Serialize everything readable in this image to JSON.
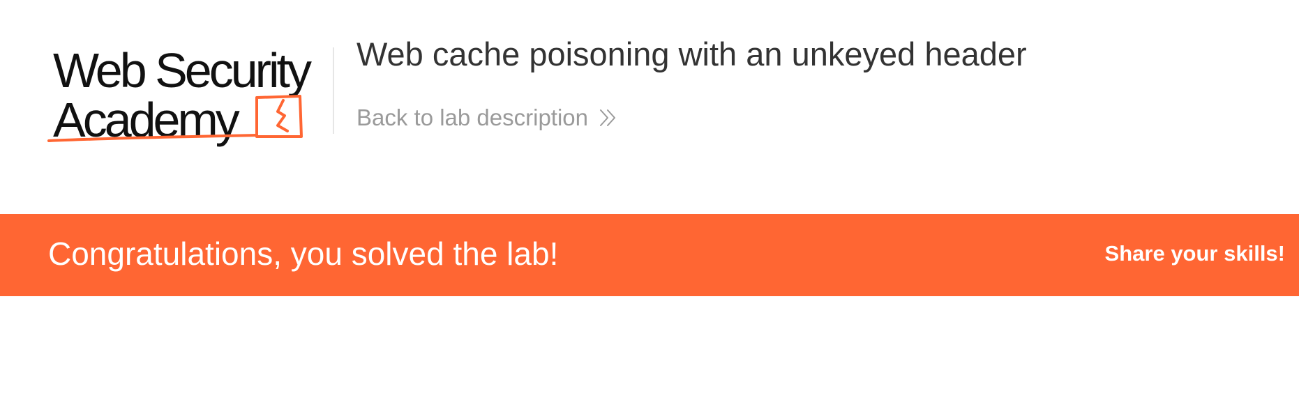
{
  "logo": {
    "line1": "Web Security",
    "line2": "Academy"
  },
  "lab": {
    "title": "Web cache poisoning with an unkeyed header",
    "back_link_label": "Back to lab description"
  },
  "banner": {
    "message": "Congratulations, you solved the lab!",
    "share_label": "Share your skills!"
  },
  "colors": {
    "accent": "#ff6633",
    "title_text": "#333333",
    "muted_text": "#9a9a9a"
  }
}
